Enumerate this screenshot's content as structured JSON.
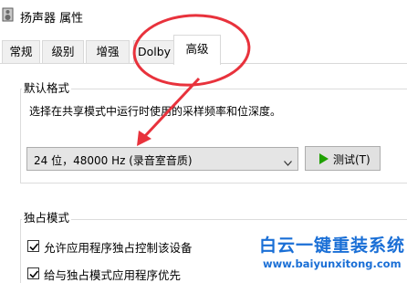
{
  "window": {
    "title": "扬声器 属性"
  },
  "tabs": [
    {
      "label": "常规",
      "active": false
    },
    {
      "label": "级别",
      "active": false
    },
    {
      "label": "增强",
      "active": false
    },
    {
      "label": "Dolby",
      "active": false
    },
    {
      "label": "高级",
      "active": true
    }
  ],
  "default_format": {
    "group_label": "默认格式",
    "description": "选择在共享模式中运行时使用的采样频率和位深度。",
    "selected_format": "24 位，48000 Hz (录音室音质)",
    "test_button_label": "测试(T)"
  },
  "exclusive_mode": {
    "group_label": "独占模式",
    "options": [
      {
        "label": "允许应用程序独占控制该设备",
        "checked": true
      },
      {
        "label": "给与独占模式应用程序优先",
        "checked": true
      }
    ]
  },
  "watermark": {
    "title": "白云一键重装系统",
    "url": "www.baiyunxitong.com"
  },
  "colors": {
    "annotation": "#e8323c",
    "watermark": "#1a6fd6",
    "play_icon": "#1fa000"
  }
}
